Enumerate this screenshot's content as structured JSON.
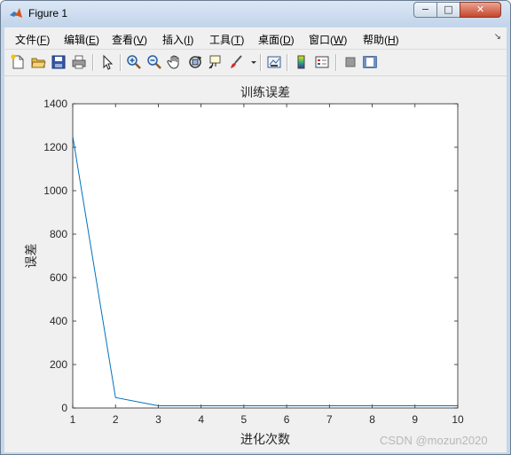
{
  "window": {
    "title": "Figure 1",
    "buttons": {
      "minimize": "−",
      "maximize": "□",
      "close": "✕"
    }
  },
  "menu": {
    "items": [
      {
        "label": "文件(",
        "key": "F",
        "tail": ")"
      },
      {
        "label": "编辑(",
        "key": "E",
        "tail": ")"
      },
      {
        "label": "查看(",
        "key": "V",
        "tail": ")"
      },
      {
        "label": "插入(",
        "key": "I",
        "tail": ")"
      },
      {
        "label": "工具(",
        "key": "T",
        "tail": ")"
      },
      {
        "label": "桌面(",
        "key": "D",
        "tail": ")"
      },
      {
        "label": "窗口(",
        "key": "W",
        "tail": ")"
      },
      {
        "label": "帮助(",
        "key": "H",
        "tail": ")"
      }
    ],
    "dock_glyph": "↘"
  },
  "toolbar": {
    "icons": [
      "new-figure-icon",
      "open-file-icon",
      "save-icon",
      "print-icon",
      "pointer-icon",
      "zoom-in-icon",
      "zoom-out-icon",
      "pan-icon",
      "rotate-3d-icon",
      "data-cursor-icon",
      "brush-icon",
      "brush-dropdown-icon",
      "link-plot-icon",
      "insert-colorbar-icon",
      "insert-legend-icon",
      "hide-plot-tools-icon",
      "show-plot-tools-icon"
    ]
  },
  "chart_data": {
    "type": "line",
    "title": "训练误差",
    "xlabel": "进化次数",
    "ylabel": "误差",
    "x": [
      1,
      2,
      3,
      4,
      5,
      6,
      7,
      8,
      9,
      10
    ],
    "series": [
      {
        "values": [
          1250,
          48,
          10,
          10,
          10,
          10,
          10,
          10,
          10,
          10
        ],
        "color": "#0072bd"
      }
    ],
    "xlim": [
      1,
      10
    ],
    "ylim": [
      0,
      1400
    ],
    "xticks": [
      1,
      2,
      3,
      4,
      5,
      6,
      7,
      8,
      9,
      10
    ],
    "yticks": [
      0,
      200,
      400,
      600,
      800,
      1000,
      1200,
      1400
    ],
    "grid": false
  },
  "watermark": "CSDN @mozun2020"
}
